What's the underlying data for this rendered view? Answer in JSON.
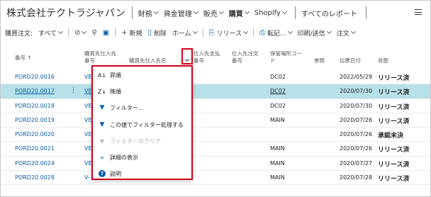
{
  "nav": {
    "company": "株式会社テクトラジャパン",
    "items": [
      {
        "label": "財務",
        "bold": false
      },
      {
        "label": "資金管理",
        "bold": false
      },
      {
        "label": "販売",
        "bold": false
      },
      {
        "label": "購買",
        "bold": true
      },
      {
        "label": "Shopify",
        "bold": false
      }
    ],
    "all_reports": "すべてのレポート"
  },
  "toolbar": {
    "title": "購買注文:",
    "filter_all": "すべて",
    "new": "新規",
    "delete": "削除",
    "home": "ホーム",
    "release": "リリース",
    "post": "転記...",
    "print_send": "印刷/送信",
    "order": "注文"
  },
  "columns": {
    "no": "番号 ↑",
    "vendor_no": "購買先仕入先\n番号",
    "vendor_name": "購買先仕入先名",
    "pay_vendor_no": "仕入先支払\n番号",
    "vendor_order_no": "仕入先注文\n番号",
    "location_code": "保管場所コー\nド",
    "reference": "参照",
    "doc_date": "伝票日付",
    "status": "状態"
  },
  "rows": [
    {
      "no": "PORD20.0016",
      "vendor": "VE",
      "location": "DC02",
      "date": "2022/05/29",
      "status": "リリース済",
      "selected": false
    },
    {
      "no": "PORD20.0017",
      "vendor": "VE",
      "location": "DC02",
      "date": "2020/07/30",
      "status": "リリース済",
      "selected": true
    },
    {
      "no": "PORD20.0018",
      "vendor": "VE",
      "location": "DC02",
      "date": "2020/07/30",
      "status": "リリース済",
      "selected": false
    },
    {
      "no": "PORD20.0019",
      "vendor": "VE",
      "location": "MAIN",
      "date": "2020/07/26",
      "status": "リリース済",
      "selected": false
    },
    {
      "no": "PORD20.0020",
      "vendor": "VE",
      "location": "",
      "date": "2020/07/26",
      "status": "承認未決",
      "selected": false
    },
    {
      "no": "PORD20.0021",
      "vendor": "VE",
      "location": "MAIN",
      "date": "2020/07/26",
      "status": "リリース済",
      "selected": false
    },
    {
      "no": "PORD20.0024",
      "vendor": "VE",
      "location": "MAIN",
      "date": "2020/07/27",
      "status": "リリース済",
      "selected": false
    },
    {
      "no": "PORD20.0028",
      "vendor": "V-",
      "location": "MAIN",
      "date": "2020/07/28",
      "status": "リリース済",
      "selected": false
    }
  ],
  "menu": {
    "items": [
      {
        "icon": "sort-asc-icon",
        "glyph": "↓",
        "label": "昇順",
        "disabled": false
      },
      {
        "icon": "sort-desc-icon",
        "glyph": "↓",
        "label": "降順",
        "disabled": false
      },
      {
        "icon": "filter-icon",
        "glyph": "▼",
        "label": "フィルター...",
        "disabled": false
      },
      {
        "icon": "filter-by-value-icon",
        "glyph": "▼",
        "label": "この値でフィルター処理する",
        "disabled": false
      },
      {
        "icon": "clear-filter-icon",
        "glyph": "▼",
        "label": "フィルターのクリア",
        "disabled": true
      },
      {
        "icon": "binoculars-icon",
        "glyph": "⊕",
        "label": "詳細の表示",
        "disabled": false
      },
      {
        "icon": "help-icon",
        "glyph": "?",
        "label": "説明",
        "disabled": false
      }
    ]
  },
  "colors": {
    "accent": "#0a5ea8",
    "selected_row": "#b6e1e8",
    "highlight_border": "#d0021b"
  }
}
